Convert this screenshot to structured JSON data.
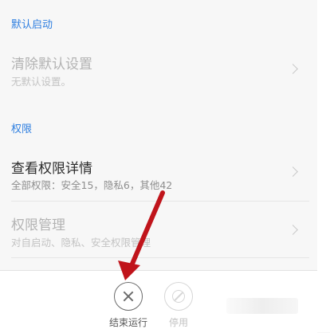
{
  "sections": {
    "default_launch": {
      "title": "默认启动",
      "clear_defaults": {
        "title": "清除默认设置",
        "subtitle": "无默认设置。"
      }
    },
    "permissions": {
      "title": "权限",
      "view_details": {
        "title": "查看权限详情",
        "subtitle": "全部权限：安全15，隐私6，其他42"
      },
      "manage": {
        "title": "权限管理",
        "subtitle": "对自启动、隐私、安全权限管理"
      }
    }
  },
  "bottom_bar": {
    "force_stop_label": "结束运行",
    "disable_label": "停用"
  },
  "icons": {
    "chevron": "chevron-right-icon",
    "force_stop": "close-icon",
    "disable": "ban-icon"
  },
  "colors": {
    "accent": "#2f7fe0",
    "annotation_arrow": "#c0141b"
  }
}
